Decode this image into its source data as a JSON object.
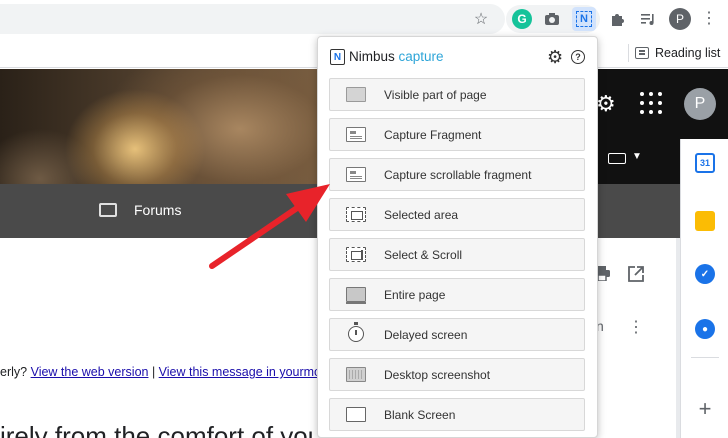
{
  "browser": {
    "toolbar_icons": [
      "star-icon",
      "grammarly-icon",
      "camera-icon",
      "nimbus-extension-icon",
      "puzzle-icon",
      "media-queue-icon"
    ],
    "grammarly_letter": "G",
    "nimbus_letter": "N",
    "profile_letter": "P",
    "reading_list_label": "Reading list"
  },
  "page": {
    "nav_forums_label": "Forums",
    "avatar_letter": "P",
    "email_line_prefix": "erly? ",
    "email_link_1": "View the web version",
    "email_separator": " | ",
    "email_link_2": "View this message in yourmobi",
    "big_text": "irely from the comfort of your",
    "partial_letter": "n",
    "side_panel_calendar_label": "31"
  },
  "popup": {
    "brand_part_1": "Nimbus",
    "brand_part_2": " capture",
    "logo_letter": "N",
    "help_label": "?",
    "items": [
      {
        "label": "Visible part of page",
        "icon": "visible-page-icon"
      },
      {
        "label": "Capture Fragment",
        "icon": "fragment-icon"
      },
      {
        "label": "Capture scrollable fragment",
        "icon": "scrollable-fragment-icon"
      },
      {
        "label": "Selected area",
        "icon": "selected-area-icon"
      },
      {
        "label": "Select & Scroll",
        "icon": "select-scroll-icon"
      },
      {
        "label": "Entire page",
        "icon": "entire-page-icon"
      },
      {
        "label": "Delayed screen",
        "icon": "timer-icon"
      },
      {
        "label": "Desktop screenshot",
        "icon": "desktop-icon"
      },
      {
        "label": "Blank Screen",
        "icon": "blank-screen-icon"
      }
    ]
  },
  "annotation": {
    "arrow_color": "#e8232a",
    "points_to": "Capture scrollable fragment"
  },
  "colors": {
    "nimbus_blue": "#2ea5d8",
    "grammarly_green": "#15c39a",
    "link_blue": "#1a0dab"
  }
}
